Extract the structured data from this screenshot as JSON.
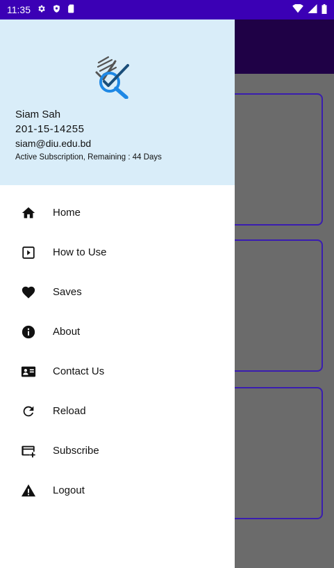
{
  "status_bar": {
    "time": "11:35",
    "left_icons": [
      "gear-icon",
      "shield-icon",
      "sim-card-icon"
    ],
    "right_icons": [
      "wifi-icon",
      "signal-icon",
      "battery-icon"
    ]
  },
  "drawer": {
    "header": {
      "logo_icon": "document-search-logo",
      "name": "Siam Sah",
      "id": "201-15-14255",
      "email": "siam@diu.edu.bd",
      "subscription": "Active Subscription, Remaining : 44 Days"
    },
    "menu": [
      {
        "label": "Home",
        "icon": "home-icon"
      },
      {
        "label": "How to Use",
        "icon": "play-box-icon"
      },
      {
        "label": "Saves",
        "icon": "heart-icon"
      },
      {
        "label": "About",
        "icon": "info-icon"
      },
      {
        "label": "Contact Us",
        "icon": "contact-card-icon"
      },
      {
        "label": "Reload",
        "icon": "reload-icon"
      },
      {
        "label": "Subscribe",
        "icon": "credit-card-add-icon"
      },
      {
        "label": "Logout",
        "icon": "warning-icon"
      }
    ]
  },
  "colors": {
    "status_bar": "#3b00b5",
    "app_bar": "#1f0146",
    "drawer_header": "#d9edf9",
    "background": "#6b6b6b",
    "card_border": "#3a1db0",
    "logo_blue": "#1e88e5"
  }
}
